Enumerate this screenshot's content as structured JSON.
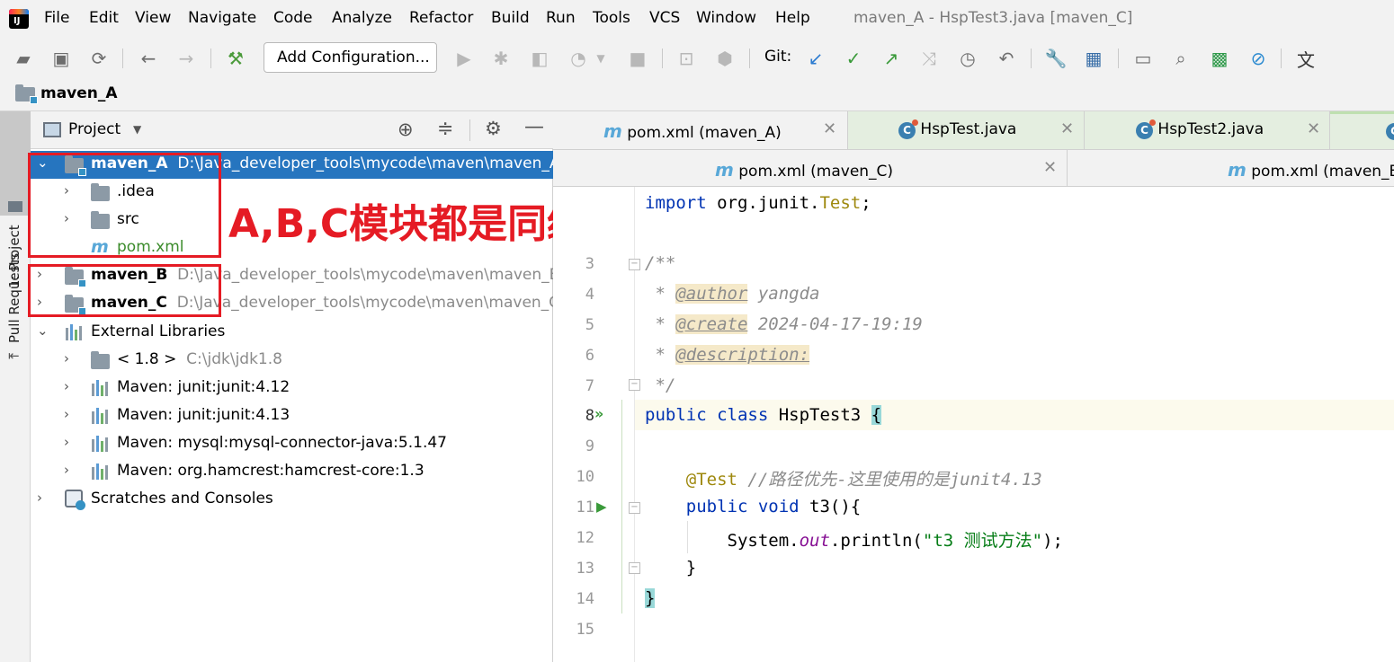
{
  "menubar": {
    "items": [
      "File",
      "Edit",
      "View",
      "Navigate",
      "Code",
      "Analyze",
      "Refactor",
      "Build",
      "Run",
      "Tools",
      "VCS",
      "Window",
      "Help"
    ],
    "window_title": "maven_A - HspTest3.java [maven_C]"
  },
  "toolbar": {
    "add_configuration": "Add Configuration...",
    "git_label": "Git:"
  },
  "breadcrumb": {
    "project_name": "maven_A"
  },
  "left_strip": {
    "project_tab": "1: Project",
    "pull_requests_tab": "Pull Requests"
  },
  "project_panel": {
    "header": "Project",
    "tree": [
      {
        "name": "maven_A",
        "path": "D:\\Java_developer_tools\\mycode\\maven\\maven_A",
        "selected": true
      },
      {
        "name": ".idea"
      },
      {
        "name": "src"
      },
      {
        "name": "pom.xml"
      },
      {
        "name": "maven_B",
        "path": "D:\\Java_developer_tools\\mycode\\maven\\maven_B"
      },
      {
        "name": "maven_C",
        "path": "D:\\Java_developer_tools\\mycode\\maven\\maven_C"
      },
      {
        "name": "External Libraries"
      },
      {
        "name": "< 1.8 >",
        "path": "C:\\jdk\\jdk1.8"
      },
      {
        "name": "Maven: junit:junit:4.12"
      },
      {
        "name": "Maven: junit:junit:4.13"
      },
      {
        "name": "Maven: mysql:mysql-connector-java:5.1.47"
      },
      {
        "name": "Maven: org.hamcrest:hamcrest-core:1.3"
      },
      {
        "name": "Scratches and Consoles"
      }
    ]
  },
  "annotation": "A,B,C模块都是同级的",
  "editor_tabs_row1": [
    {
      "label": "pom.xml (maven_A)",
      "icon": "maven-m-icon"
    },
    {
      "label": "HspTest.java",
      "icon": "java-class-icon"
    },
    {
      "label": "HspTest2.java",
      "icon": "java-class-icon"
    }
  ],
  "editor_tabs_row2": [
    {
      "label": "pom.xml (maven_C)",
      "icon": "maven-m-icon"
    },
    {
      "label": "pom.xml (maven_B",
      "icon": "maven-m-icon"
    }
  ],
  "editor": {
    "line_numbers": [
      "3",
      "4",
      "5",
      "6",
      "7",
      "8",
      "9",
      "10",
      "11",
      "12",
      "13",
      "14",
      "15"
    ],
    "code": {
      "import_kw": "import",
      "import_pkg": " org.junit.",
      "import_cls": "Test",
      "import_end": ";",
      "doc_open": "/**",
      "author_tag": "@author",
      "author_val": " yangda",
      "create_tag": "@create",
      "create_val": " 2024-04-17-19:19",
      "desc_tag": "@description:",
      "doc_close": " */",
      "public_class_kw": "public class",
      "class_name": " HspTest3 ",
      "brace_open": "{",
      "test_ann": "@Test",
      "test_comment": " //路径优先-这里使用的是junit4.13",
      "public_void_kw": "public void",
      "method_sig": " t3(){",
      "sysout_pre": "System.",
      "sysout_out": "out",
      "sysout_post": ".println(",
      "sysout_str": "\"t3 测试方法\"",
      "sysout_end": ");",
      "inner_close": "}",
      "brace_close": "}"
    }
  }
}
